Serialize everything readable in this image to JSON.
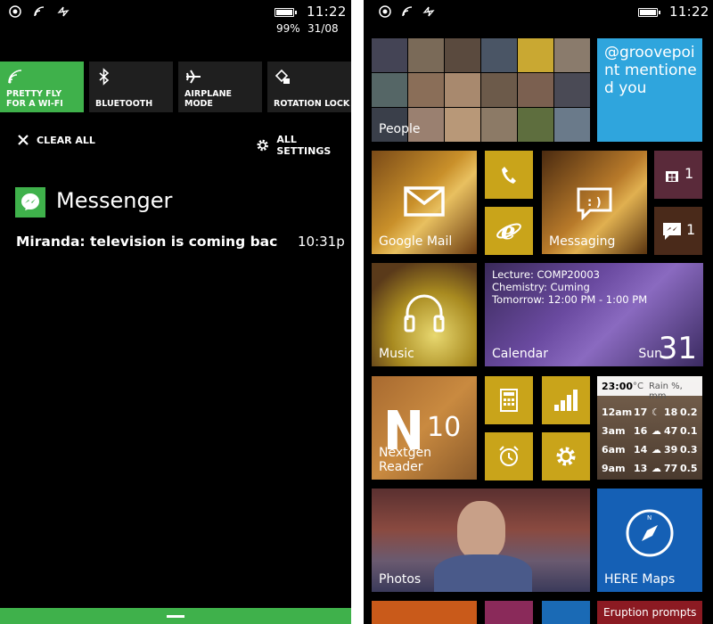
{
  "left": {
    "status": {
      "time": "11:22",
      "battery": "99%",
      "date": "31/08"
    },
    "quick_actions": [
      {
        "label": "PRETTY FLY FOR A WI-FI",
        "icon": "wifi-icon",
        "active": true
      },
      {
        "label": "BLUETOOTH",
        "icon": "bluetooth-icon",
        "active": false
      },
      {
        "label": "AIRPLANE MODE",
        "icon": "airplane-icon",
        "active": false
      },
      {
        "label": "ROTATION LOCK",
        "icon": "rotation-lock-icon",
        "active": false
      }
    ],
    "clear_all": "CLEAR ALL",
    "all_settings": "ALL SETTINGS",
    "notification_app": "Messenger",
    "notification_text": "Miranda: television is coming back ne",
    "notification_time": "10:31p"
  },
  "right": {
    "status": {
      "time": "11:22"
    },
    "tiles": {
      "people": "People",
      "twitter": "@groovepoint mentioned you",
      "mail": "Google Mail",
      "store_count": "1",
      "messaging": "Messaging",
      "messenger_count": "1",
      "music": "Music",
      "calendar": {
        "lines": [
          "Lecture: COMP20003",
          "Chemistry: Cuming",
          "Tomorrow: 12:00 PM - 1:00 PM"
        ],
        "label": "Calendar",
        "day": "Sun",
        "date": "31"
      },
      "nextgen": {
        "label": "Nextgen Reader",
        "count": "10"
      },
      "weather": {
        "time": "23:00",
        "unit": "°C",
        "header": "Rain %, mm",
        "rows": [
          {
            "t": "12am",
            "temp": "17",
            "rain": "18",
            "mm": "0.2"
          },
          {
            "t": "3am",
            "temp": "16",
            "rain": "47",
            "mm": "0.1"
          },
          {
            "t": "6am",
            "temp": "14",
            "rain": "39",
            "mm": "0.3"
          },
          {
            "t": "9am",
            "temp": "13",
            "rain": "77",
            "mm": "0.5"
          }
        ]
      },
      "photos": "Photos",
      "here_maps": "HERE Maps",
      "eruption": "Eruption prompts"
    }
  },
  "colors": {
    "accent": "#3fb14b",
    "twitter": "#2fa5dd",
    "maps": "#1560b5",
    "gold": "#c9a41a",
    "eruption": "#8b1a22"
  }
}
